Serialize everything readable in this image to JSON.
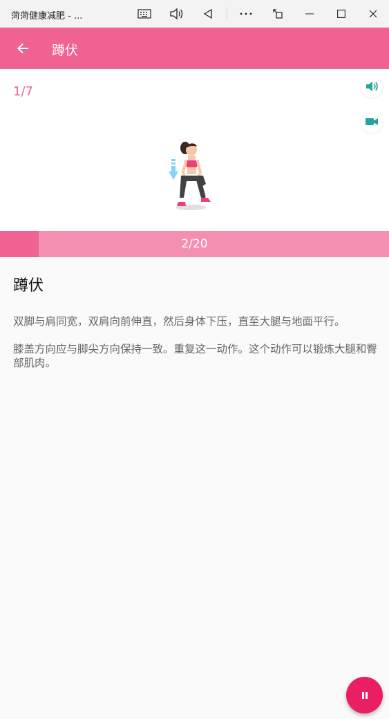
{
  "window": {
    "title": "菏菏健康减肥 - ...",
    "controls": [
      "keyboard-icon",
      "speaker-icon",
      "back-triangle-icon",
      "more-icon",
      "restore-icon",
      "minimize-icon",
      "maximize-icon",
      "close-icon"
    ]
  },
  "header": {
    "back_icon": "arrow-left-icon",
    "title": "蹲伏",
    "background": "#f06292"
  },
  "exercise": {
    "counter": "1/7",
    "sound_icon": "volume-icon",
    "video_icon": "video-camera-icon",
    "accent": "#26a69a"
  },
  "progress": {
    "label": "2/20",
    "value": 0.1,
    "fill_color": "#f06292",
    "track_color": "#f48fb1"
  },
  "detail": {
    "title": "蹲伏",
    "paragraphs": [
      "双脚与肩同宽，双肩向前伸直，然后身体下压，直至大腿与地面平行。",
      "膝盖方向应与脚尖方向保持一致。重复这一动作。这个动作可以锻炼大腿和臀部肌肉。"
    ]
  },
  "fab": {
    "icon": "pause-icon",
    "color": "#e91e63"
  }
}
